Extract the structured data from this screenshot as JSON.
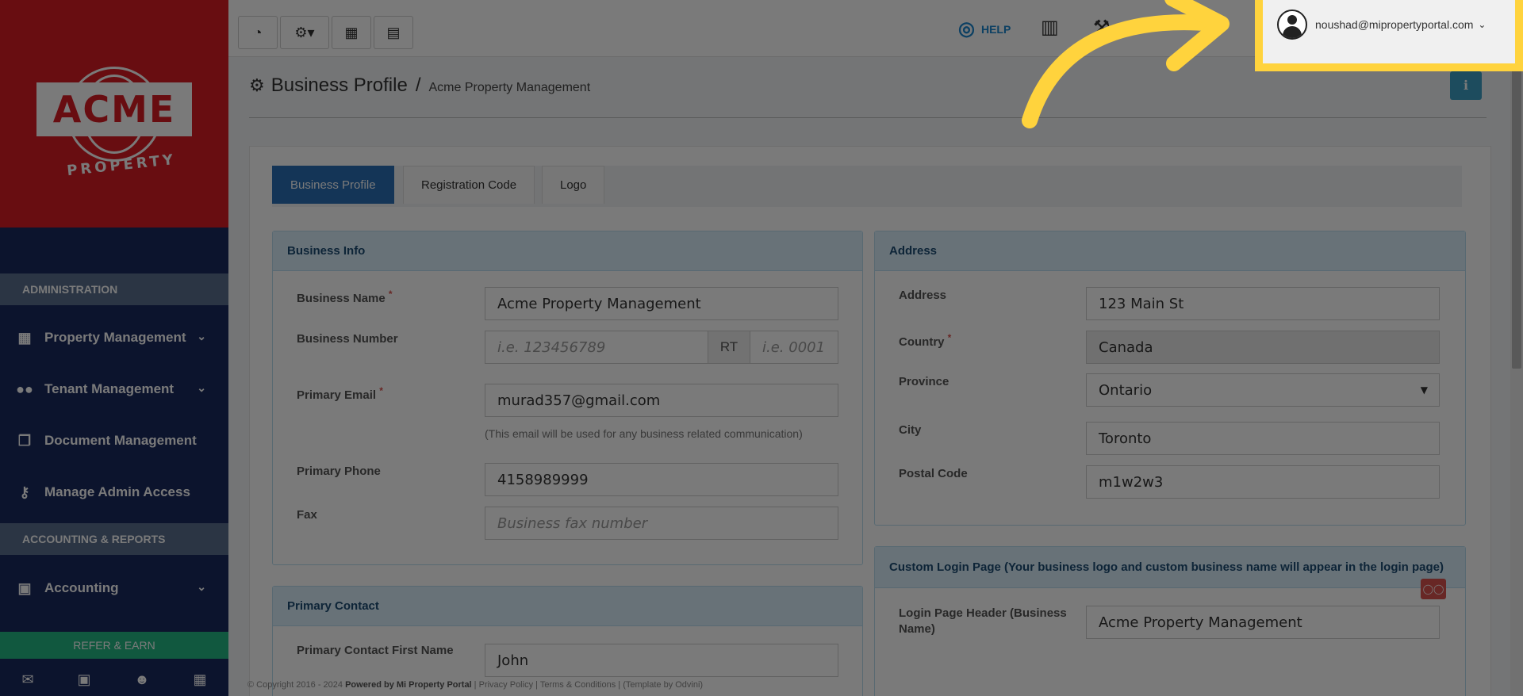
{
  "brand": {
    "logo_text": "ACME",
    "logo_sub": "PROPERTY",
    "primary_color": "#d91c24",
    "sidebar_color": "#1b2a5e"
  },
  "sidebar": {
    "section_admin": "ADMINISTRATION",
    "items": [
      {
        "label": "Property Management",
        "icon": "building-icon"
      },
      {
        "label": "Tenant Management",
        "icon": "users-icon"
      },
      {
        "label": "Document Management",
        "icon": "documents-icon"
      },
      {
        "label": "Manage Admin Access",
        "icon": "key-icon"
      }
    ],
    "section_accounting": "ACCOUNTING & REPORTS",
    "accounting": {
      "label": "Accounting",
      "icon": "money-icon"
    },
    "refer_label": "REFER & EARN"
  },
  "topbar": {
    "help_label": "HELP",
    "user_email": "noushad@mipropertyportal.com"
  },
  "page": {
    "title": "Business Profile",
    "separator": "/",
    "subtitle": "Acme Property Management"
  },
  "tabs": [
    {
      "label": "Business Profile",
      "active": true
    },
    {
      "label": "Registration Code",
      "active": false
    },
    {
      "label": "Logo",
      "active": false
    }
  ],
  "business_info": {
    "header": "Business Info",
    "name_label": "Business Name",
    "name_value": "Acme Property Management",
    "number_label": "Business Number",
    "number_placeholder": "i.e. 123456789",
    "rt_label": "RT",
    "rt_placeholder": "i.e. 0001",
    "email_label": "Primary Email",
    "email_value": "murad357@gmail.com",
    "email_help": "(This email will be used for any business related communication)",
    "phone_label": "Primary Phone",
    "phone_value": "4158989999",
    "fax_label": "Fax",
    "fax_placeholder": "Business fax number"
  },
  "address": {
    "header": "Address",
    "address_label": "Address",
    "address_value": "123 Main St",
    "country_label": "Country",
    "country_value": "Canada",
    "province_label": "Province",
    "province_value": "Ontario",
    "city_label": "City",
    "city_value": "Toronto",
    "postal_label": "Postal Code",
    "postal_value": "m1w2w3"
  },
  "custom_login": {
    "header": "Custom Login Page (Your business logo and custom business name will appear in the login page)",
    "header_label_1": "Login Page Header (Business",
    "header_label_2": "Name)",
    "header_value": "Acme Property Management"
  },
  "primary_contact": {
    "header": "Primary Contact",
    "first_name_label": "Primary Contact First Name",
    "first_name_value": "John"
  },
  "footer": {
    "copyright": "© Copyright 2016 - 2024",
    "powered": "Powered by Mi Property Portal",
    "privacy": "Privacy Policy",
    "terms": "Terms & Conditions",
    "template": "(Template by Odvini)"
  },
  "required_mark": "*"
}
